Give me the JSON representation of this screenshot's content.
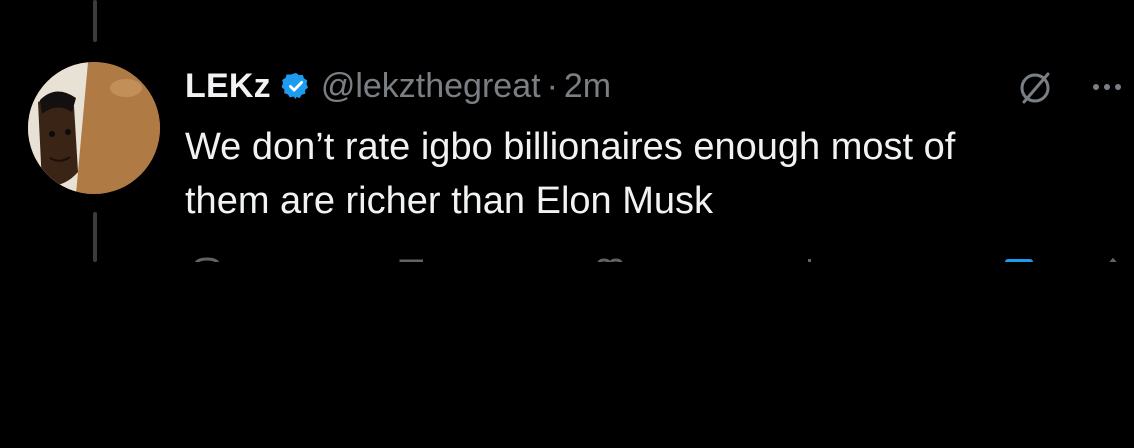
{
  "tweet": {
    "display_name": "LEKz",
    "handle": "@lekzthegreat",
    "separator": "·",
    "time": "2m",
    "text_lines": [
      "We don’t rate igbo billionaires enough most of",
      "them are richer than Elon Musk"
    ]
  },
  "icons": {
    "verified": "verified-badge-icon",
    "grok": "grok-icon",
    "more": "more-options-icon"
  },
  "colors": {
    "background": "#000000",
    "primary_text": "#f1f2f3",
    "secondary_text": "#7a7f84",
    "verified_blue": "#1d9bf0",
    "thread_line": "#3a3d40"
  }
}
